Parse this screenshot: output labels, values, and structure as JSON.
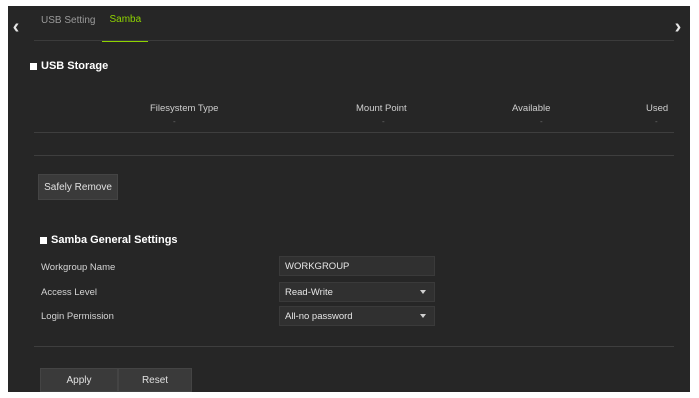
{
  "nav": {
    "left_arrow": "‹",
    "right_arrow": "›"
  },
  "tabs": [
    {
      "label": "USB Setting",
      "active": false
    },
    {
      "label": "Samba",
      "active": true
    }
  ],
  "usb_storage": {
    "title": "USB Storage",
    "columns": [
      "Filesystem Type",
      "Mount Point",
      "Available",
      "Used"
    ],
    "row": [
      "-",
      "-",
      "-",
      "-"
    ],
    "safely_remove_label": "Safely Remove"
  },
  "samba": {
    "title": "Samba General Settings",
    "workgroup_label": "Workgroup Name",
    "workgroup_value": "WORKGROUP",
    "access_label": "Access Level",
    "access_value": "Read-Write",
    "login_label": "Login Permission",
    "login_value": "All-no password"
  },
  "actions": {
    "apply_label": "Apply",
    "reset_label": "Reset"
  },
  "colors": {
    "accent": "#8fd400",
    "panel": "#262626"
  }
}
